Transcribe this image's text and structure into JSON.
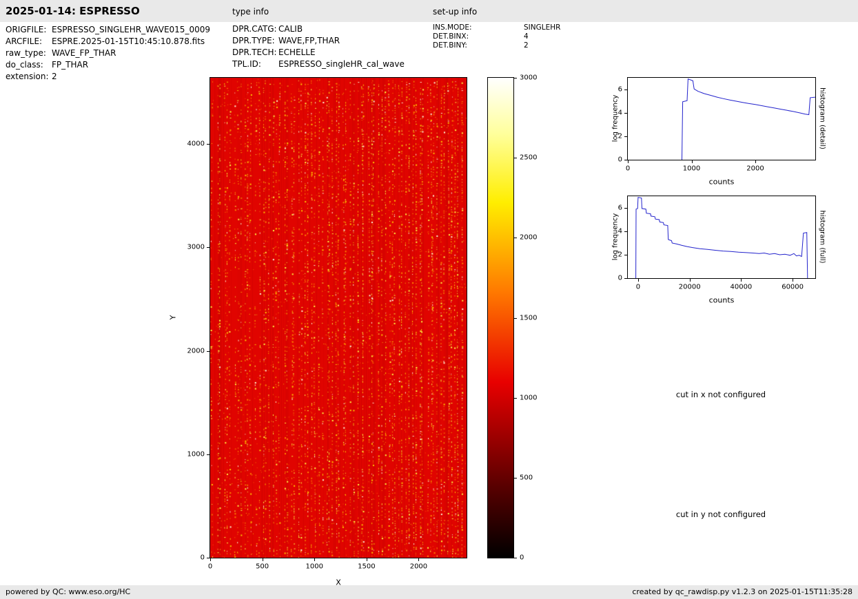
{
  "header": {
    "title": "2025-01-14: ESPRESSO",
    "type_info_label": "type info",
    "setup_info_label": "set-up info"
  },
  "file_info": {
    "rows": [
      {
        "label": "ORIGFILE:",
        "value": "ESPRESSO_SINGLEHR_WAVE015_0009"
      },
      {
        "label": "ARCFILE:",
        "value": "ESPRE.2025-01-15T10:45:10.878.fits"
      },
      {
        "label": "raw_type:",
        "value": "WAVE_FP_THAR"
      },
      {
        "label": "do_class:",
        "value": "FP_THAR"
      },
      {
        "label": "extension:",
        "value": "2"
      }
    ]
  },
  "type_info": {
    "rows": [
      {
        "label": "DPR.CATG:",
        "value": "CALIB"
      },
      {
        "label": "DPR.TYPE:",
        "value": "WAVE,FP,THAR"
      },
      {
        "label": "DPR.TECH:",
        "value": "ECHELLE"
      },
      {
        "label": "TPL.ID:",
        "value": "ESPRESSO_singleHR_cal_wave"
      }
    ]
  },
  "setup_info": {
    "rows": [
      {
        "label": "INS.MODE:",
        "value": "SINGLEHR"
      },
      {
        "label": "DET.BINX:",
        "value": "4"
      },
      {
        "label": "DET.BINY:",
        "value": "2"
      }
    ]
  },
  "messages": {
    "cut_x": "cut in x not configured",
    "cut_y": "cut in y not configured"
  },
  "footer": {
    "left": "powered by QC: www.eso.org/HC",
    "right": "created by qc_rawdisp.py v1.2.3 on 2025-01-15T11:35:28"
  },
  "chart_data": [
    {
      "id": "raw-image",
      "type": "heatmap",
      "xlabel": "X",
      "ylabel": "Y",
      "xlim": [
        0,
        2460
      ],
      "ylim": [
        0,
        4640
      ],
      "xticks": [
        0,
        500,
        1000,
        1500,
        2000
      ],
      "yticks": [
        0,
        1000,
        2000,
        3000,
        4000
      ],
      "description": "ESPRESSO raw echelle calibration frame (WAVE,FP,THAR): near-uniform saturated red background (~1000 counts on hot colormap) covered by dense vertical columns of small bright yellow/white Fabry-Perot emission-line dots, denser toward the right side",
      "background": "#e00400",
      "stripe_count": 72,
      "seed": 7,
      "colorbar": {
        "vmin": 0,
        "vmax": 3000,
        "ticks": [
          0,
          500,
          1000,
          1500,
          2000,
          2500,
          3000
        ],
        "colormap": "hot",
        "stops": [
          {
            "pos": 0.0,
            "color": "#000000"
          },
          {
            "pos": 0.15,
            "color": "#5a0000"
          },
          {
            "pos": 0.365,
            "color": "#e80000"
          },
          {
            "pos": 0.55,
            "color": "#ff7700"
          },
          {
            "pos": 0.74,
            "color": "#ffee00"
          },
          {
            "pos": 0.88,
            "color": "#ffff99"
          },
          {
            "pos": 1.0,
            "color": "#ffffff"
          }
        ]
      }
    },
    {
      "id": "histogram-detail",
      "type": "line",
      "xlabel": "counts",
      "ylabel": "log frequency",
      "right_label": "histogram (detail)",
      "line_color": "#2222cc",
      "xlim": [
        0,
        2940
      ],
      "ylim": [
        0,
        7
      ],
      "xticks": [
        0,
        1000,
        2000
      ],
      "yticks": [
        0,
        2,
        4,
        6
      ],
      "points": [
        [
          848,
          0
        ],
        [
          860,
          4.95
        ],
        [
          930,
          5.05
        ],
        [
          945,
          6.9
        ],
        [
          1020,
          6.75
        ],
        [
          1040,
          6.05
        ],
        [
          1100,
          5.85
        ],
        [
          1200,
          5.65
        ],
        [
          1300,
          5.5
        ],
        [
          1400,
          5.35
        ],
        [
          1500,
          5.22
        ],
        [
          1600,
          5.1
        ],
        [
          1700,
          5.0
        ],
        [
          1800,
          4.9
        ],
        [
          1900,
          4.8
        ],
        [
          2000,
          4.72
        ],
        [
          2100,
          4.62
        ],
        [
          2200,
          4.52
        ],
        [
          2300,
          4.42
        ],
        [
          2400,
          4.32
        ],
        [
          2500,
          4.22
        ],
        [
          2600,
          4.12
        ],
        [
          2700,
          4.0
        ],
        [
          2780,
          3.9
        ],
        [
          2840,
          3.85
        ],
        [
          2860,
          5.3
        ],
        [
          2940,
          5.35
        ]
      ]
    },
    {
      "id": "histogram-full",
      "type": "line",
      "xlabel": "counts",
      "ylabel": "log frequency",
      "right_label": "histogram (full)",
      "line_color": "#2222cc",
      "xlim": [
        -4000,
        68800
      ],
      "ylim": [
        0,
        7
      ],
      "xticks": [
        0,
        20000,
        40000,
        60000
      ],
      "yticks": [
        0,
        2,
        4,
        6
      ],
      "points": [
        [
          -900,
          0
        ],
        [
          -800,
          5.9
        ],
        [
          -200,
          5.95
        ],
        [
          0,
          6.9
        ],
        [
          1300,
          6.85
        ],
        [
          1500,
          5.95
        ],
        [
          3000,
          5.9
        ],
        [
          3200,
          5.55
        ],
        [
          4800,
          5.5
        ],
        [
          5000,
          5.3
        ],
        [
          6500,
          5.25
        ],
        [
          6700,
          5.05
        ],
        [
          8200,
          5.0
        ],
        [
          8400,
          4.8
        ],
        [
          9800,
          4.75
        ],
        [
          10000,
          4.55
        ],
        [
          11500,
          4.5
        ],
        [
          11700,
          3.3
        ],
        [
          13000,
          3.2
        ],
        [
          13200,
          3.0
        ],
        [
          15000,
          2.92
        ],
        [
          17000,
          2.8
        ],
        [
          19000,
          2.7
        ],
        [
          21000,
          2.62
        ],
        [
          24000,
          2.52
        ],
        [
          27000,
          2.45
        ],
        [
          30000,
          2.38
        ],
        [
          33000,
          2.32
        ],
        [
          36000,
          2.28
        ],
        [
          39000,
          2.22
        ],
        [
          42000,
          2.18
        ],
        [
          45000,
          2.14
        ],
        [
          47000,
          2.1
        ],
        [
          49000,
          2.15
        ],
        [
          51000,
          2.05
        ],
        [
          53000,
          2.1
        ],
        [
          55000,
          2.0
        ],
        [
          57000,
          2.05
        ],
        [
          59000,
          1.95
        ],
        [
          60500,
          2.1
        ],
        [
          61500,
          1.9
        ],
        [
          62500,
          1.95
        ],
        [
          63500,
          1.85
        ],
        [
          64200,
          3.85
        ],
        [
          65500,
          3.9
        ],
        [
          65800,
          0
        ]
      ]
    }
  ]
}
